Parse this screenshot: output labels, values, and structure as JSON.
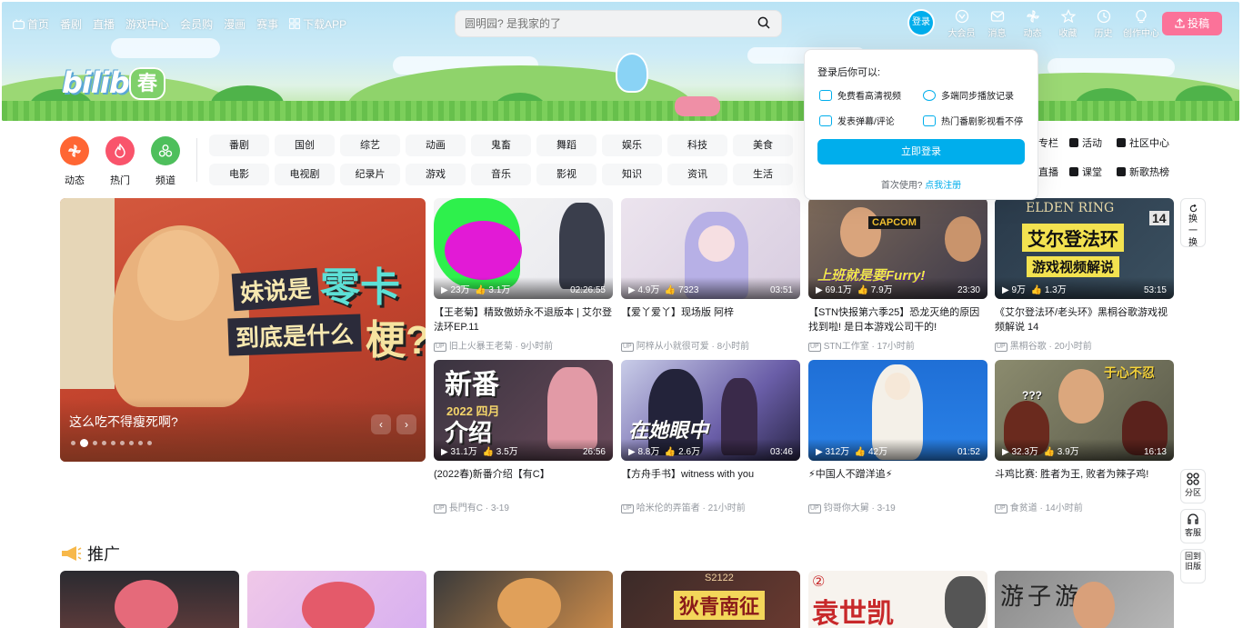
{
  "nav": {
    "left": [
      "首页",
      "番剧",
      "直播",
      "游戏中心",
      "会员购",
      "漫画",
      "赛事",
      "下载APP"
    ],
    "search_placeholder": "圆明园? 是我家的了",
    "login": "登录",
    "right": [
      "大会员",
      "消息",
      "动态",
      "收藏",
      "历史",
      "创作中心"
    ],
    "upload": "投稿"
  },
  "banner": {
    "logo": "bilibili",
    "logo_sub": "春"
  },
  "channels": {
    "circles": [
      "动态",
      "热门",
      "频道"
    ],
    "row1": [
      "番剧",
      "国创",
      "综艺",
      "动画",
      "鬼畜",
      "舞蹈",
      "娱乐",
      "科技",
      "美食"
    ],
    "row2": [
      "电影",
      "电视剧",
      "纪录片",
      "游戏",
      "音乐",
      "影视",
      "知识",
      "资讯",
      "生活"
    ],
    "extras": [
      "专栏",
      "活动",
      "社区中心",
      "直播",
      "课堂",
      "新歌热榜"
    ]
  },
  "carousel": {
    "title": "这么吃不得瘦死啊?",
    "texts": [
      "妹说是",
      "零卡",
      "到底是什么",
      "梗?"
    ],
    "prev": "‹",
    "next": "›"
  },
  "videos": [
    {
      "views": "23万",
      "likes": "3.1万",
      "duration": "02:26:55",
      "title": "【王老菊】精致傲娇永不退版本 | 艾尔登法环EP.11",
      "up": "旧上火暴王老菊",
      "time": "9小时前"
    },
    {
      "views": "4.9万",
      "likes": "7323",
      "duration": "03:51",
      "title": "【爱丫爱丫】现场版 阿梓",
      "up": "阿梓从小就很可爱",
      "time": "8小时前"
    },
    {
      "views": "69.1万",
      "likes": "7.9万",
      "duration": "23:30",
      "title": "【STN快报第六季25】恐龙灭绝的原因找到啦! 是日本游戏公司干的!",
      "up": "STN工作室",
      "time": "17小时前",
      "thumb_text": "CAPCOM",
      "thumb_text2": "上班就是要Furry!"
    },
    {
      "views": "9万",
      "likes": "1.3万",
      "duration": "53:15",
      "title": "《艾尔登法环/老头环》黑桐谷歌游戏视频解说 14",
      "up": "黑桐谷歌",
      "time": "20小时前",
      "thumb_text": "ELDEN RING",
      "thumb_text2": "艾尔登法环",
      "thumb_text3": "游戏视频解说",
      "thumb_num": "14"
    },
    {
      "views": "31.1万",
      "likes": "3.5万",
      "duration": "26:56",
      "title": "(2022春)新番介绍【有C】",
      "up": "長門有C",
      "time": "3-19",
      "thumb_text": "新番",
      "thumb_text2": "2022 四月",
      "thumb_text3": "介绍"
    },
    {
      "views": "8.8万",
      "likes": "2.6万",
      "duration": "03:46",
      "title": "【方舟手书】witness with you",
      "up": "哈米伦的弄笛者",
      "time": "21小时前",
      "thumb_text": "在她眼中"
    },
    {
      "views": "312万",
      "likes": "42万",
      "duration": "01:52",
      "title": "⚡中国人不蹭洋追⚡",
      "up": "钧哥你大舅",
      "time": "3-19"
    },
    {
      "views": "32.3万",
      "likes": "3.9万",
      "duration": "16:13",
      "title": "斗鸡比赛: 胜者为王, 败者为辣子鸡!",
      "up": "食贫道",
      "time": "14小时前",
      "thumb_text": "于心不忍",
      "thumb_text2": "???"
    }
  ],
  "side": {
    "refresh": [
      "换",
      "一",
      "换"
    ],
    "fenqu": "分区",
    "kefu": "客服",
    "back": [
      "回到",
      "旧版"
    ]
  },
  "promo": {
    "title": "推广",
    "tiles": [
      "",
      "",
      "",
      "狄青南征",
      "袁世凯",
      "游子游录"
    ],
    "tile_badges": [
      "",
      "",
      "",
      "S2122",
      "②",
      ""
    ]
  },
  "popover": {
    "title": "登录后你可以:",
    "features": [
      "免费看高清视频",
      "多端同步播放记录",
      "发表弹幕/评论",
      "热门番剧影视看不停"
    ],
    "button": "立即登录",
    "foot_text": "首次使用?",
    "foot_link": "点我注册"
  },
  "colors": {
    "brand_blue": "#00aeec",
    "brand_pink": "#fb7299"
  }
}
